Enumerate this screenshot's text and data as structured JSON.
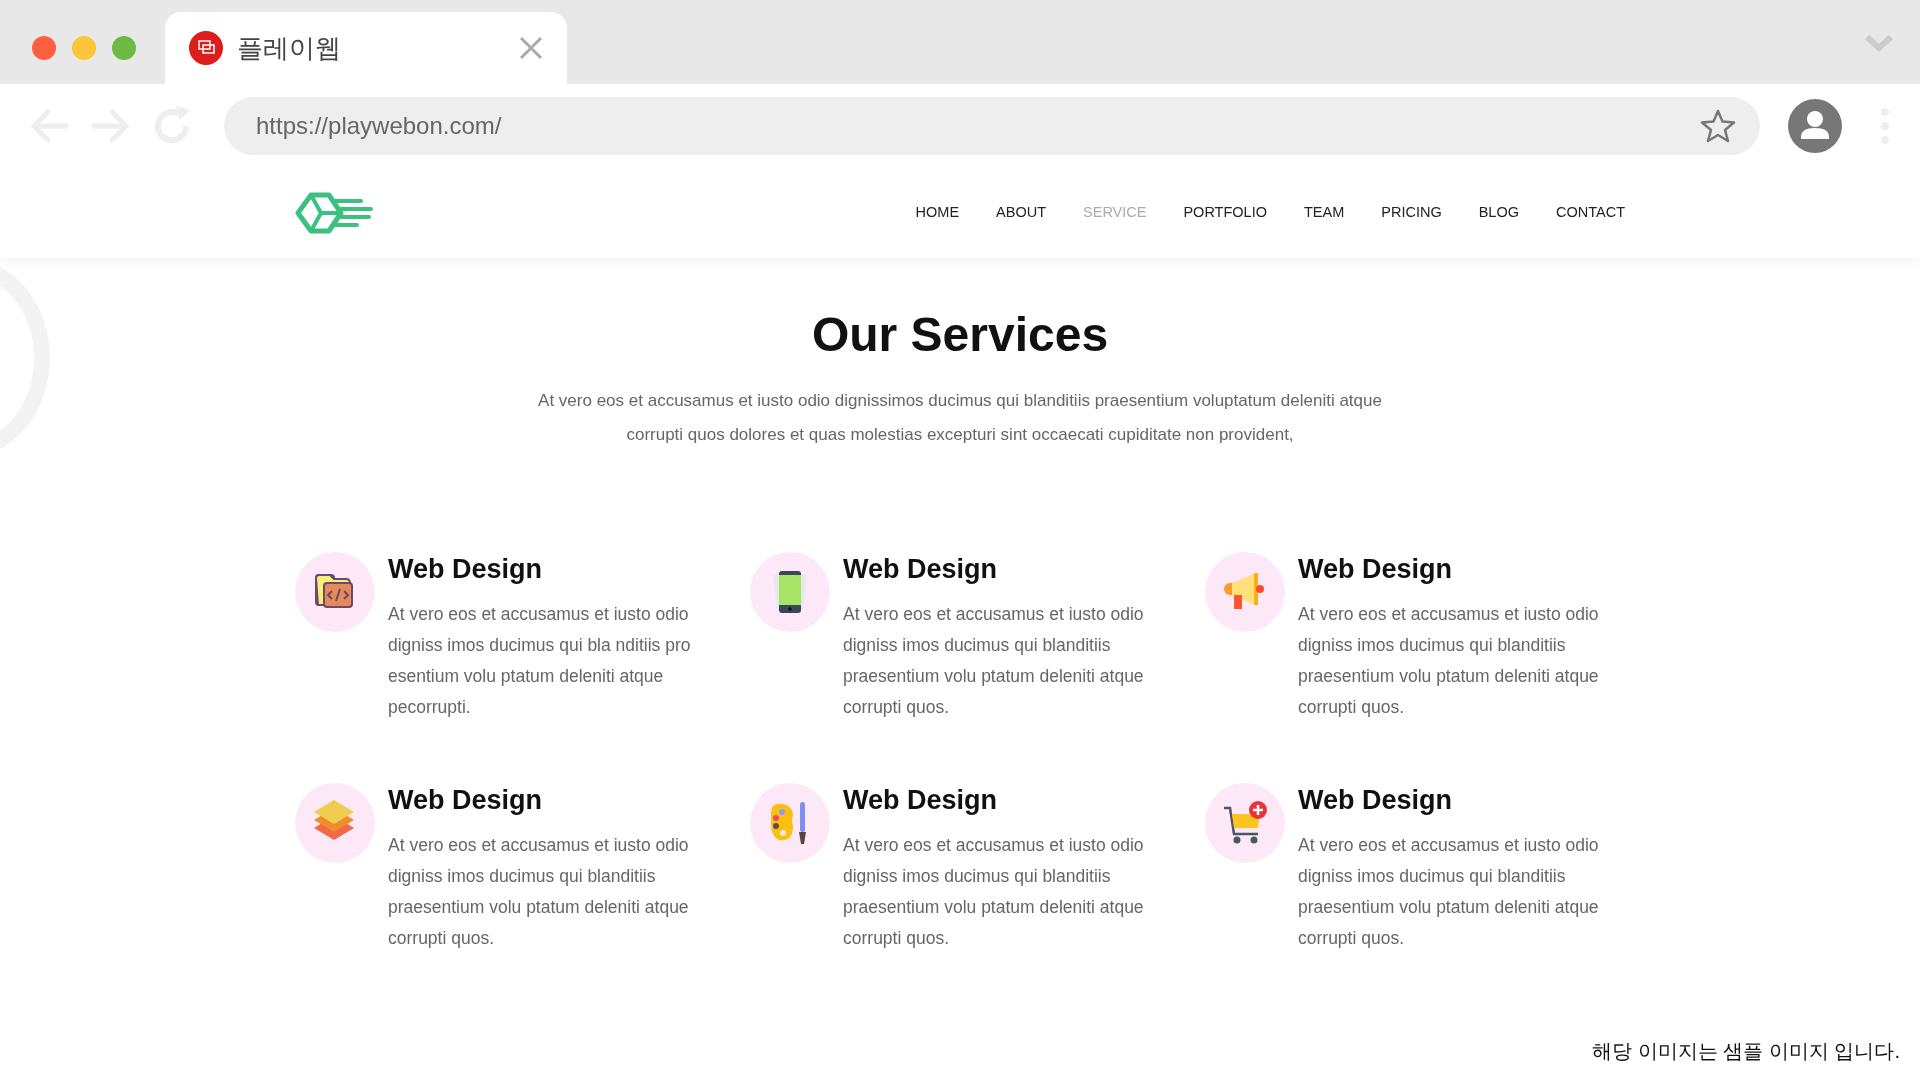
{
  "browser": {
    "tab": {
      "title": "플레이웹"
    },
    "url": "https://playwebon.com/"
  },
  "nav": [
    {
      "label": "HOME",
      "selected": false
    },
    {
      "label": "ABOUT",
      "selected": false
    },
    {
      "label": "SERVICE",
      "selected": true
    },
    {
      "label": "PORTFOLIO",
      "selected": false
    },
    {
      "label": "TEAM",
      "selected": false
    },
    {
      "label": "PRICING",
      "selected": false
    },
    {
      "label": "BLOG",
      "selected": false
    },
    {
      "label": "CONTACT",
      "selected": false
    }
  ],
  "section": {
    "title": "Our Services",
    "intro": "At vero eos et accusamus et iusto odio dignissimos ducimus qui blanditiis praesentium voluptatum deleniti atque corrupti quos dolores et quas molestias excepturi sint occaecati cupiditate non provident,"
  },
  "services": [
    {
      "kind": "folder",
      "title": "Web Design",
      "text": "At vero eos et accusamus et iusto odio digniss imos ducimus qui bla nditiis pro esentium volu ptatum deleniti atque pecorrupti."
    },
    {
      "kind": "phone",
      "title": "Web Design",
      "text": "At vero eos et accusamus et iusto odio digniss imos ducimus qui blanditiis praesentium volu ptatum deleniti atque corrupti quos."
    },
    {
      "kind": "megaphone",
      "title": "Web Design",
      "text": "At vero eos et accusamus et iusto odio digniss imos ducimus qui blanditiis praesentium volu ptatum deleniti atque corrupti quos."
    },
    {
      "kind": "layers",
      "title": "Web Design",
      "text": "At vero eos et accusamus et iusto odio digniss imos ducimus qui blanditiis praesentium volu ptatum deleniti atque corrupti quos."
    },
    {
      "kind": "palette",
      "title": "Web Design",
      "text": "At vero eos et accusamus et iusto odio digniss imos ducimus qui blanditiis praesentium volu ptatum deleniti atque corrupti quos."
    },
    {
      "kind": "cart",
      "title": "Web Design",
      "text": "At vero eos et accusamus et iusto odio digniss imos ducimus qui blanditiis praesentium volu ptatum deleniti atque corrupti quos."
    }
  ],
  "footer_note": "해당 이미지는 샘플 이미지 입니다."
}
